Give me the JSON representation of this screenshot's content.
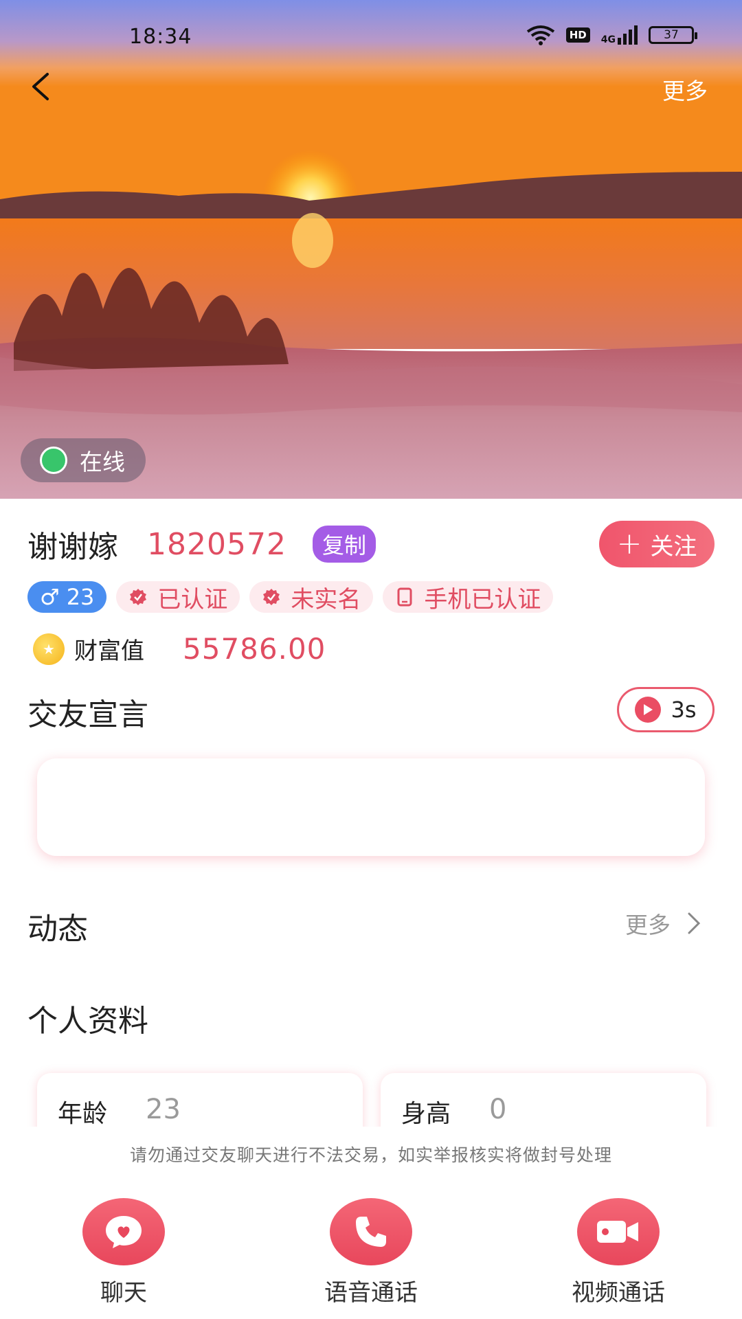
{
  "status_bar": {
    "time": "18:34",
    "hd_label": "HD",
    "network_label": "4G",
    "battery": "37"
  },
  "header": {
    "back_icon": "chevron-left-icon",
    "more_label": "更多"
  },
  "hero": {
    "online_label": "在线",
    "online_color": "#38c56b"
  },
  "profile": {
    "nickname": "谢谢嫁",
    "user_id": "1820572",
    "copy_label": "复制",
    "follow_label": "关注",
    "gender_symbol": "♂",
    "age": "23",
    "tags": [
      "已认证",
      "未实名",
      "手机已认证"
    ],
    "wealth_label": "财富值",
    "wealth_value": "55786.00"
  },
  "intro": {
    "title": "交友宣言",
    "voice_duration": "3s"
  },
  "moments": {
    "title": "动态",
    "more_label": "更多"
  },
  "personal_info": {
    "title": "个人资料",
    "fields": [
      {
        "label": "年龄",
        "value": "23"
      },
      {
        "label": "身高",
        "value": "0"
      }
    ]
  },
  "footer": {
    "warning": "请勿通过交友聊天进行不法交易，如实举报核实将做封号处理",
    "actions": [
      {
        "label": "聊天",
        "icon": "chat-heart-icon"
      },
      {
        "label": "语音通话",
        "icon": "phone-icon"
      },
      {
        "label": "视频通话",
        "icon": "video-camera-icon"
      }
    ]
  },
  "colors": {
    "accent": "#e04d62",
    "follow": "#f0556c",
    "copy_badge": "#a45ce6",
    "gender_badge": "#4a8ef0"
  }
}
